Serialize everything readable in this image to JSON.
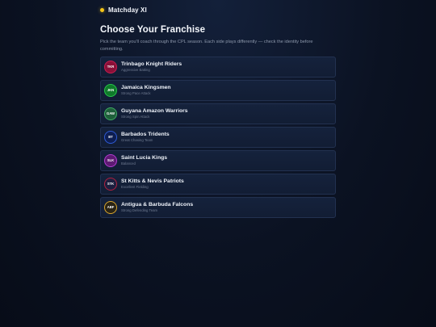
{
  "brand": {
    "name": "Matchday XI",
    "accent_color": "#f5c518"
  },
  "page": {
    "title": "Choose Your Franchise",
    "subtitle": "Pick the team you'll coach through the CPL season. Each side plays differently — check the identity before committing."
  },
  "teams": [
    {
      "abbr": "TKR",
      "name": "Trinbago Knight Riders",
      "style": "Aggressive Batting",
      "fill": "#8a1038",
      "ring": "#c81e50"
    },
    {
      "abbr": "JKN",
      "name": "Jamaica Kingsmen",
      "style": "Strong Pace Attack",
      "fill": "#0f7a2a",
      "ring": "#27c24a"
    },
    {
      "abbr": "GAW",
      "name": "Guyana Amazon Warriors",
      "style": "Strong Spin Attack",
      "fill": "#1e5f3a",
      "ring": "#3fa862"
    },
    {
      "abbr": "BT",
      "name": "Barbados Tridents",
      "style": "Great Chasing Team",
      "fill": "#0d1e52",
      "ring": "#2f5bd6"
    },
    {
      "abbr": "SLK",
      "name": "Saint Lucia Kings",
      "style": "Balanced",
      "fill": "#5e1a73",
      "ring": "#b13ccf"
    },
    {
      "abbr": "STK",
      "name": "St Kitts & Nevis Patriots",
      "style": "Excellent Fielding",
      "fill": "#1c1f3f",
      "ring": "#b0203f"
    },
    {
      "abbr": "ABF",
      "name": "Antigua & Barbuda Falcons",
      "style": "Strong Defending Team",
      "fill": "#2a2415",
      "ring": "#d9a52c"
    }
  ]
}
